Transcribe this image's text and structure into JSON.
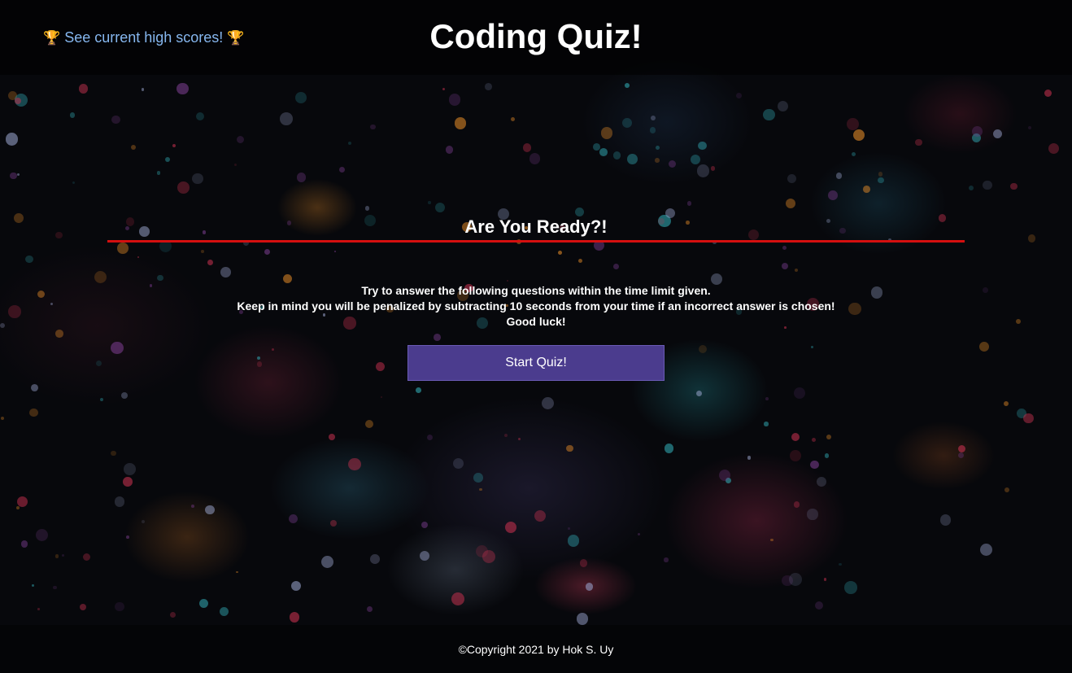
{
  "header": {
    "highscores_icon": "trophy-icon",
    "highscores_label": "See current high scores!",
    "title": "Coding Quiz!"
  },
  "intro": {
    "heading": "Are You Ready?!",
    "accent_color": "#d40f0f",
    "instructions": [
      "Try to answer the following questions within the time limit given.",
      "Keep in mind you will be penalized by subtracting 10 seconds from your time if an incorrect answer is chosen!",
      "Good luck!"
    ],
    "start_label": "Start Quiz!",
    "start_color": "#4b3c8e"
  },
  "footer": {
    "copyright": "©Copyright 2021 by Hok S. Uy"
  },
  "colors": {
    "background": "#07080c",
    "link": "#86b7ef",
    "trophy": "#e5a823"
  }
}
